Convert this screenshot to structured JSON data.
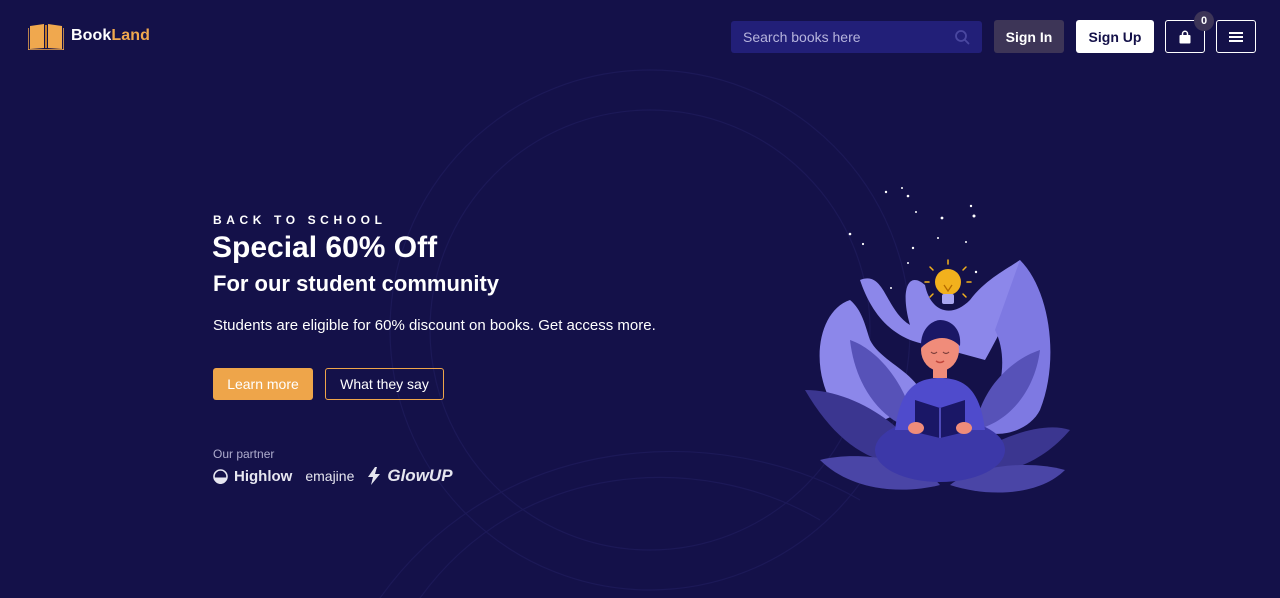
{
  "header": {
    "logo": {
      "text_primary": "Book",
      "text_accent": "Land"
    },
    "search": {
      "placeholder": "Search books here"
    },
    "sign_in_label": "Sign In",
    "sign_up_label": "Sign Up",
    "cart_count": "0"
  },
  "hero": {
    "eyebrow": "BACK TO SCHOOL",
    "headline": "Special 60% Off",
    "subheadline": "For our student community",
    "description": "Students are eligible for 60% discount on books. Get access more.",
    "primary_button": "Learn more",
    "secondary_button": "What they say"
  },
  "partners": {
    "label": "Our partner",
    "items": [
      "Highlow",
      "emajine",
      "GlowUP"
    ]
  },
  "colors": {
    "background": "#141149",
    "accent": "#eea54a",
    "search_bg": "#221f78",
    "muted_button": "#3d3557"
  },
  "icons": [
    "book-logo-icon",
    "search-icon",
    "shopping-bag-icon",
    "hamburger-menu-icon",
    "highlow-logo-icon",
    "glowup-bolt-icon"
  ]
}
